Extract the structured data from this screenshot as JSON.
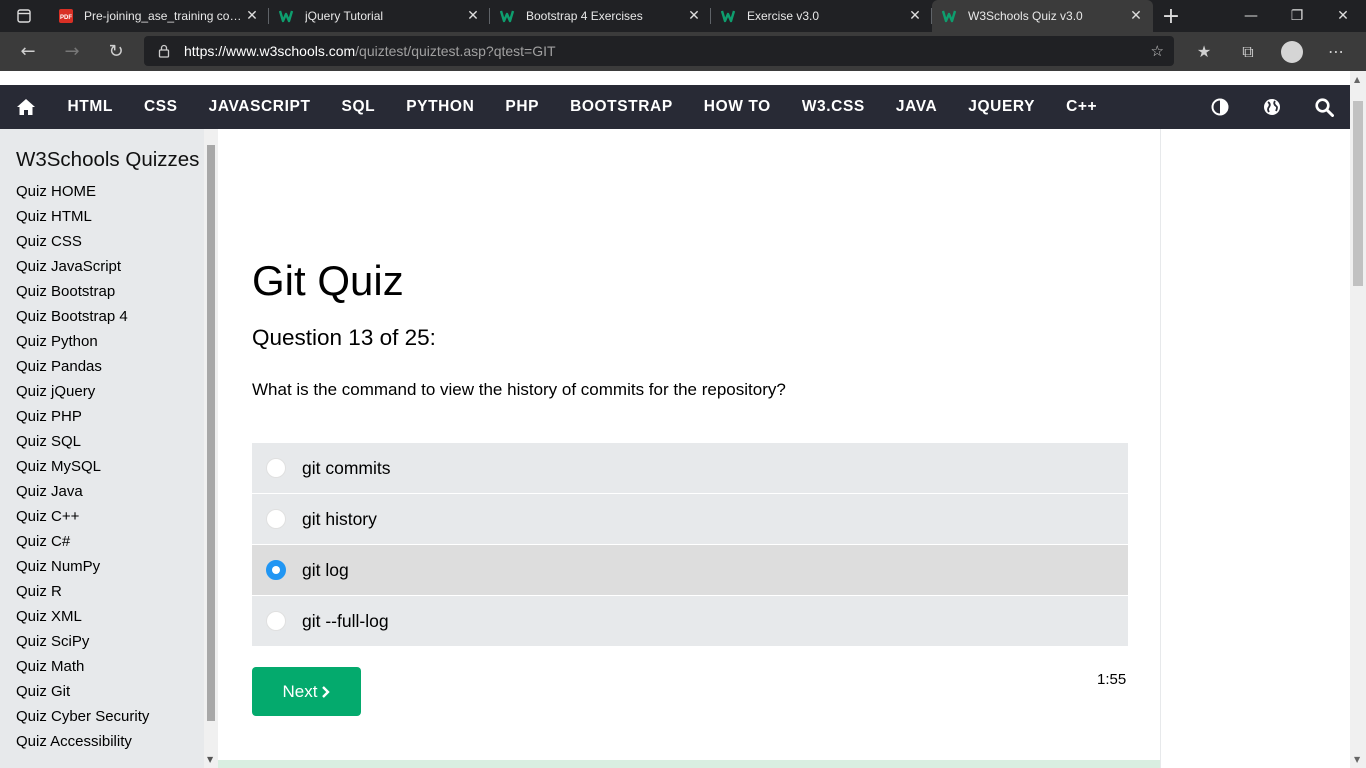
{
  "browser": {
    "tabs": [
      {
        "title": "Pre-joining_ase_training content",
        "favicon": "pdf-icon",
        "active": false
      },
      {
        "title": "jQuery Tutorial",
        "favicon": "w3schools-icon",
        "active": false
      },
      {
        "title": "Bootstrap 4 Exercises",
        "favicon": "w3schools-icon",
        "active": false
      },
      {
        "title": "Exercise v3.0",
        "favicon": "w3schools-icon",
        "active": false
      },
      {
        "title": "W3Schools Quiz v3.0",
        "favicon": "w3schools-icon",
        "active": true
      }
    ],
    "url_host": "https://www.w3schools.com",
    "url_path": "/quiztest/quiztest.asp?qtest=GIT",
    "accent": "#0e9e6e"
  },
  "topnav": {
    "links": [
      "HTML",
      "CSS",
      "JAVASCRIPT",
      "SQL",
      "PYTHON",
      "PHP",
      "BOOTSTRAP",
      "HOW TO",
      "W3.CSS",
      "JAVA",
      "JQUERY",
      "C++"
    ],
    "background": "#282a35"
  },
  "sidebar": {
    "title": "W3Schools Quizzes",
    "items": [
      "Quiz HOME",
      "Quiz HTML",
      "Quiz CSS",
      "Quiz JavaScript",
      "Quiz Bootstrap",
      "Quiz Bootstrap 4",
      "Quiz Python",
      "Quiz Pandas",
      "Quiz jQuery",
      "Quiz PHP",
      "Quiz SQL",
      "Quiz MySQL",
      "Quiz Java",
      "Quiz C++",
      "Quiz C#",
      "Quiz NumPy",
      "Quiz R",
      "Quiz XML",
      "Quiz SciPy",
      "Quiz Math",
      "Quiz Git",
      "Quiz Cyber Security",
      "Quiz Accessibility"
    ]
  },
  "quiz": {
    "title": "Git Quiz",
    "question_number": "Question 13 of 25:",
    "question": "What is the command to view the history of commits for the repository?",
    "answers": [
      "git commits",
      "git history",
      "git log",
      "git --full-log"
    ],
    "selected_index": 2,
    "next_label": "Next",
    "timer": "1:55",
    "button_color": "#04aa6d",
    "radio_selected_color": "#2196f3"
  }
}
